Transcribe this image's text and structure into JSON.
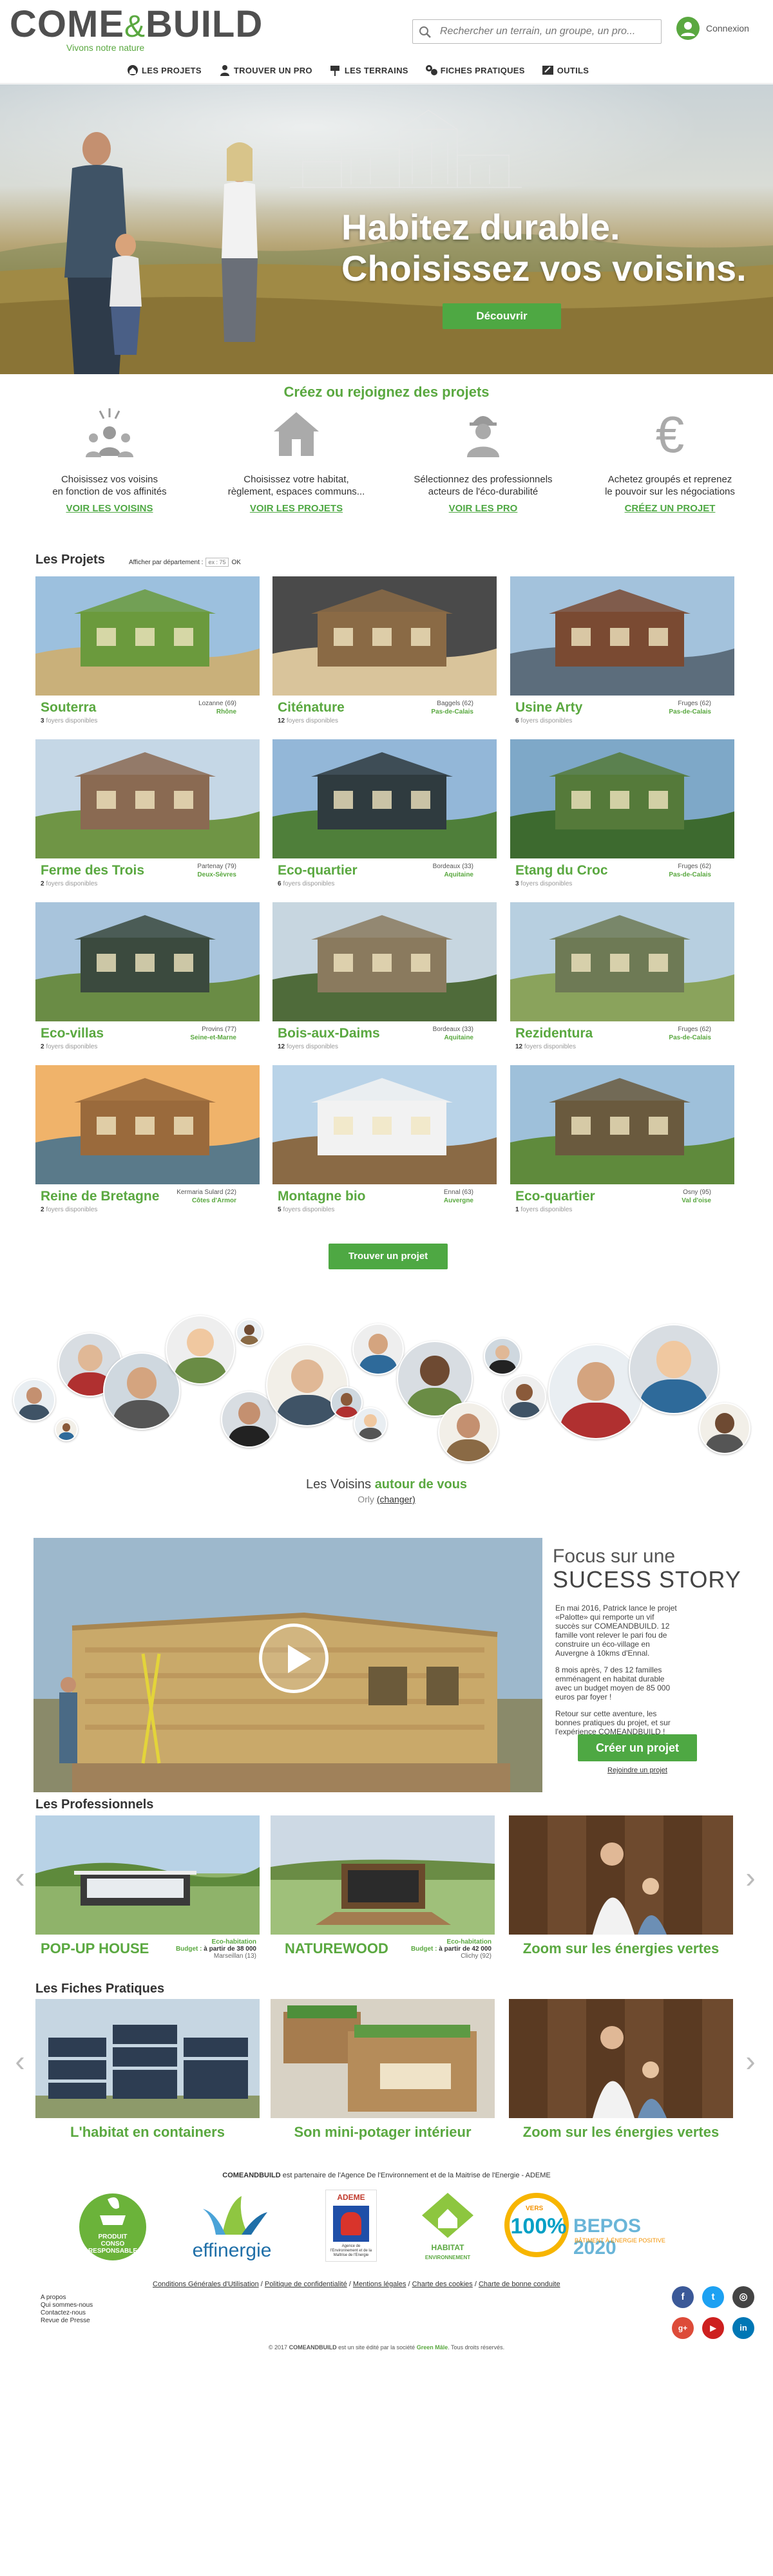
{
  "brand": {
    "logo_left": "COME",
    "logo_amp": "&",
    "logo_right": "BUILD",
    "tagline": "Vivons notre nature"
  },
  "search": {
    "placeholder": "Rechercher un terrain, un groupe, un pro..."
  },
  "login": {
    "label": "Connexion"
  },
  "nav": [
    {
      "label": "LES PROJETS",
      "icon": "house-icon"
    },
    {
      "label": "TROUVER UN PRO",
      "icon": "person-icon"
    },
    {
      "label": "LES TERRAINS",
      "icon": "sign-icon"
    },
    {
      "label": "FICHES PRATIQUES",
      "icon": "wrench-icon"
    },
    {
      "label": "OUTILS",
      "icon": "tools-icon"
    }
  ],
  "hero": {
    "line1": "Habitez durable.",
    "line2": "Choisissez vos voisins.",
    "button": "Découvrir"
  },
  "create": {
    "title": "Créez ou rejoignez des projets",
    "features": [
      {
        "text1": "Choisissez vos voisins",
        "text2": "en fonction de vos affinités",
        "link": "VOIR LES VOISINS",
        "icon": "group-icon"
      },
      {
        "text1": "Choisissez votre habitat,",
        "text2": "règlement, espaces communs...",
        "link": "VOIR LES PROJETS",
        "icon": "home-icon"
      },
      {
        "text1": "Sélectionnez des professionnels",
        "text2": "acteurs de l'éco-durabilité",
        "link": "VOIR LES PRO",
        "icon": "worker-icon"
      },
      {
        "text1": "Achetez groupés et reprenez",
        "text2": "le pouvoir sur les négociations",
        "link": "CRÉEZ UN PROJET",
        "icon": "euro-icon"
      }
    ]
  },
  "projects": {
    "heading": "Les Projets",
    "filter_label": "Afficher par département :",
    "filter_value": "ex : 75",
    "filter_ok": "OK",
    "foyers_suffix": "foyers disponibles",
    "items": [
      {
        "name": "Souterra",
        "foyers": "3",
        "city": "Lozanne (69)",
        "dept": "Rhône"
      },
      {
        "name": "Citénature",
        "foyers": "12",
        "city": "Baggels (62)",
        "dept": "Pas-de-Calais"
      },
      {
        "name": "Usine Arty",
        "foyers": "6",
        "city": "Fruges (62)",
        "dept": "Pas-de-Calais"
      },
      {
        "name": "Ferme des Trois",
        "foyers": "2",
        "city": "Partenay (79)",
        "dept": "Deux-Sèvres"
      },
      {
        "name": "Eco-quartier",
        "foyers": "6",
        "city": "Bordeaux (33)",
        "dept": "Aquitaine"
      },
      {
        "name": "Etang du Croc",
        "foyers": "3",
        "city": "Fruges (62)",
        "dept": "Pas-de-Calais"
      },
      {
        "name": "Eco-villas",
        "foyers": "2",
        "city": "Provins (77)",
        "dept": "Seine-et-Marne"
      },
      {
        "name": "Bois-aux-Daims",
        "foyers": "12",
        "city": "Bordeaux (33)",
        "dept": "Aquitaine"
      },
      {
        "name": "Rezidentura",
        "foyers": "12",
        "city": "Fruges (62)",
        "dept": "Pas-de-Calais"
      },
      {
        "name": "Reine de Bretagne",
        "foyers": "2",
        "city": "Kermaria Sulard (22)",
        "dept": "Côtes d'Armor"
      },
      {
        "name": "Montagne bio",
        "foyers": "5",
        "city": "Ennal (63)",
        "dept": "Auvergne"
      },
      {
        "name": "Eco-quartier",
        "foyers": "1",
        "city": "Osny (95)",
        "dept": "Val d'oise"
      }
    ],
    "button": "Trouver un projet"
  },
  "voisins": {
    "prefix": "Les Voisins",
    "accent": "autour de vous",
    "city": "Orly",
    "change": "(changer)"
  },
  "focus": {
    "title1": "Focus sur une",
    "title2": "SUCESS STORY",
    "p1": "En mai 2016, Patrick lance le projet «Palotte» qui remporte un vif succès sur COMEANDBUILD. 12 famille vont relever le pari fou de construire un éco-village en Auvergne à 10kms d'Ennal.",
    "p2": "8 mois après, 7 des 12 familles emménagent en habitat durable avec un budget moyen de 85 000 euros par foyer !",
    "p3": "Retour sur cette aventure, les bonnes pratiques du projet, et sur l'expérience COMEANDBUILD !",
    "button": "Créer un projet",
    "link": "Rejoindre un projet"
  },
  "pros": {
    "heading": "Les Professionnels",
    "items": [
      {
        "name": "POP-UP HOUSE",
        "type": "Eco-habitation",
        "budget_label": "Budget :",
        "budget": "à partir de 38 000",
        "city": "Marseillan (13)"
      },
      {
        "name": "NATUREWOOD",
        "type": "Eco-habitation",
        "budget_label": "Budget :",
        "budget": "à partir de 42 000",
        "city": "Clichy (92)"
      },
      {
        "name": "Zoom sur les énergies vertes"
      }
    ]
  },
  "fiches": {
    "heading": "Les Fiches Pratiques",
    "items": [
      {
        "name": "L'habitat en containers"
      },
      {
        "name": "Son mini-potager intérieur"
      },
      {
        "name": "Zoom sur les énergies vertes"
      }
    ]
  },
  "partners": {
    "brand": "COMEANDBUILD",
    "text": "est partenaire de l'Agence De l'Environnement et de la Maitrise de l'Energie - ADEME",
    "logos": {
      "conso1": "PRODUIT",
      "conso2": "CONSO",
      "conso3": "RESPONSABLE",
      "effinergie": "effinergie",
      "ademe": "ADEME",
      "ademe_sub": "Agence de l'Environnement et de la Maîtrise de l'Energie",
      "habitat1": "HABITAT",
      "habitat2": "ENVIRONNEMENT",
      "bepos_vers": "VERS",
      "bepos_pct": "100%",
      "bepos": "BEPOS 2020",
      "bepos_sub": "BÂTIMENT À ÉNERGIE POSITIVE"
    }
  },
  "footer": {
    "side_links": [
      "A propos",
      "Qui sommes-nous",
      "Contactez-nous",
      "Revue de Presse"
    ],
    "legal": [
      "Conditions Générales d'Utilisation",
      "Politique de confidentialité",
      "Mentions légales",
      "Charte des cookies",
      "Charte de bonne conduite"
    ],
    "copy_pre": "© 2017",
    "copy_brand": "COMEANDBUILD",
    "copy_mid": "est un site édité par la société",
    "copy_company": "Green Mâle",
    "copy_post": ". Tous droits réservés.",
    "social": [
      "f",
      "t",
      "◎",
      "g+",
      "▶",
      "in"
    ]
  },
  "colors": {
    "accent": "#5aa840",
    "button": "#4ea843",
    "text": "#333333"
  }
}
